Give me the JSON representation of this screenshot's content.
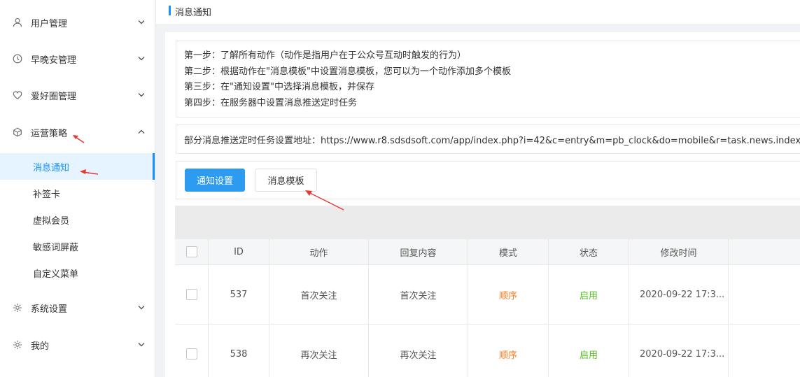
{
  "sidebar": {
    "menus": [
      {
        "label": "用户管理",
        "icon": "user-icon"
      },
      {
        "label": "早晚安管理",
        "icon": "clock-icon"
      },
      {
        "label": "爱好圈管理",
        "icon": "heart-icon"
      },
      {
        "label": "运营策略",
        "icon": "cube-icon"
      },
      {
        "label": "系统设置",
        "icon": "gear-icon"
      },
      {
        "label": "我的",
        "icon": "gear-icon"
      }
    ],
    "sub_items": [
      {
        "label": "消息通知",
        "active": true
      },
      {
        "label": "补签卡"
      },
      {
        "label": "虚拟会员"
      },
      {
        "label": "敏感词屏蔽"
      },
      {
        "label": "自定义菜单"
      }
    ]
  },
  "header": {
    "title": "消息通知"
  },
  "steps": [
    "第一步：了解所有动作（动作是指用户在于公众号互动时触发的行为）",
    "第二步：根据动作在\"消息模板\"中设置消息模板，您可以为一个动作添加多个模板",
    "第三步：在\"通知设置\"中选择消息模板，并保存",
    "第四步：在服务器中设置消息推送定时任务"
  ],
  "url_text": "部分消息推送定时任务设置地址：https://www.r8.sdsdsoft.com/app/index.php?i=42&c=entry&m=pb_clock&do=mobile&r=task.news.index",
  "buttons": {
    "notify_settings": "通知设置",
    "message_template": "消息模板"
  },
  "table": {
    "headers": [
      "ID",
      "动作",
      "回复内容",
      "模式",
      "状态",
      "修改时间"
    ],
    "rows": [
      {
        "id": "537",
        "action": "首次关注",
        "reply": "首次关注",
        "mode": "顺序",
        "state": "启用",
        "time": "2020-09-22 17:3..."
      },
      {
        "id": "538",
        "action": "再次关注",
        "reply": "再次关注",
        "mode": "顺序",
        "state": "启用",
        "time": "2020-09-22 17:3..."
      }
    ]
  },
  "colors": {
    "accent": "#1890ff",
    "primary_button": "#2d9cf0",
    "mode": "#f47e23",
    "state": "#52c41a",
    "annotation_arrow": "#e53935"
  }
}
